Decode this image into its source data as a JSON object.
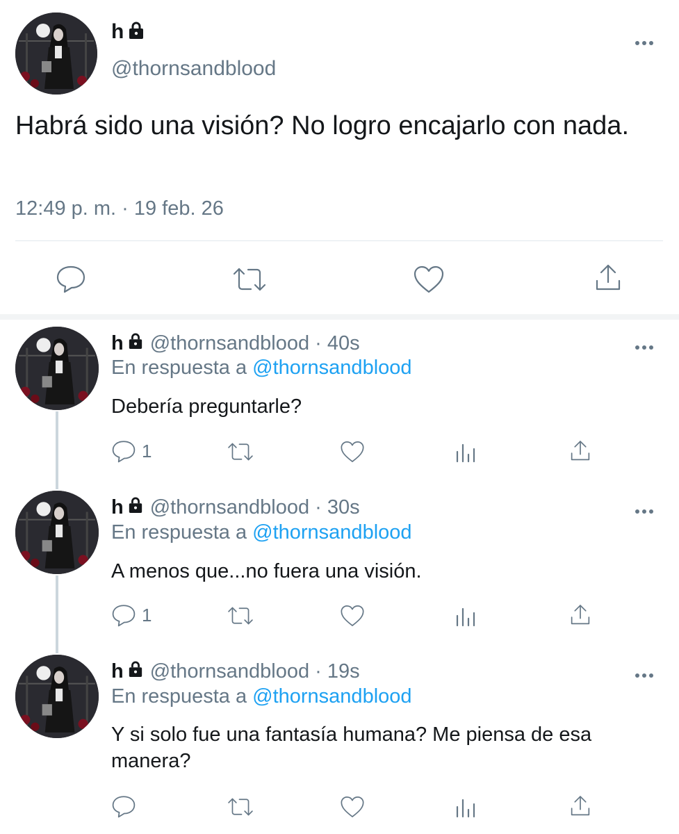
{
  "main_tweet": {
    "display_name": "h",
    "handle": "@thornsandblood",
    "text": "Habrá sido una visión? No logro encajarlo con nada.",
    "timestamp": "12:49 p. m. · 19 feb. 26",
    "actions": [
      "reply-icon",
      "retweet-icon",
      "like-icon",
      "share-icon"
    ]
  },
  "replies": [
    {
      "display_name": "h",
      "handle_time": "@thornsandblood · 40s",
      "reply_prefix": "En respuesta a",
      "reply_to": "@thornsandblood",
      "text": "Debería preguntarle?",
      "reply_count": "1"
    },
    {
      "display_name": "h",
      "handle_time": "@thornsandblood · 30s",
      "reply_prefix": "En respuesta a",
      "reply_to": "@thornsandblood",
      "text": "A menos que...no fuera una visión.",
      "reply_count": "1"
    },
    {
      "display_name": "h",
      "handle_time": "@thornsandblood · 19s",
      "reply_prefix": "En respuesta a",
      "reply_to": "@thornsandblood",
      "text": "Y si solo fue una fantasía humana? Me piensa de esa manera?",
      "reply_count": ""
    }
  ],
  "colors": {
    "text": "#14171a",
    "muted": "#657786",
    "link": "#1da1f2",
    "divider": "#e1e8ed"
  }
}
